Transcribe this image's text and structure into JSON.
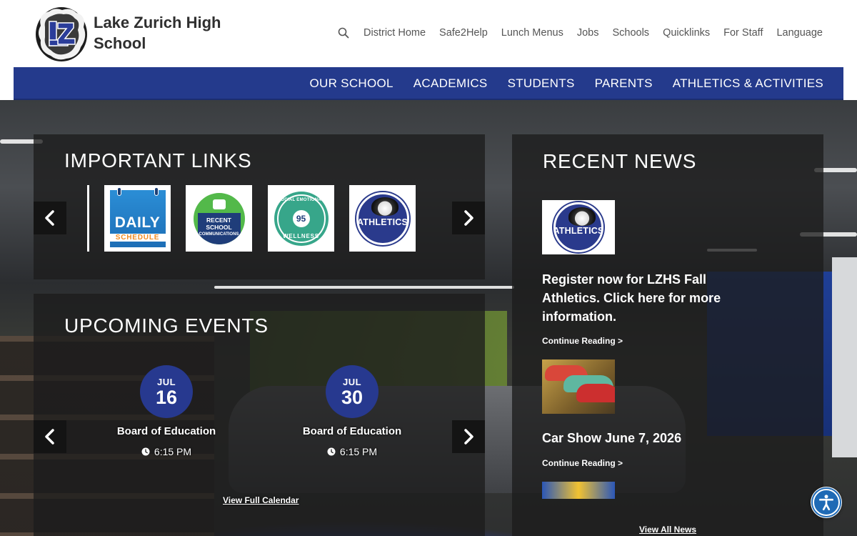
{
  "header": {
    "school_name": "Lake Zurich High School",
    "utility_nav": [
      "District Home",
      "Safe2Help",
      "Lunch Menus",
      "Jobs",
      "Schools",
      "Quicklinks",
      "For Staff",
      "Language"
    ]
  },
  "main_nav": {
    "items": [
      "OUR SCHOOL",
      "ACADEMICS",
      "STUDENTS",
      "PARENTS",
      "ATHLETICS & ACTIVITIES"
    ]
  },
  "important_links": {
    "title": "IMPORTANT LINKS",
    "tiles": [
      {
        "word": "DAILY",
        "sub": "SCHEDULE"
      },
      {
        "lines": [
          "RECENT",
          "SCHOOL",
          "COMMUNICATIONS"
        ]
      },
      {
        "top": "SOCIAL EMOTIONAL",
        "number": "95",
        "bottom": "WELLNESS"
      },
      {
        "word": "ATHLETICS"
      }
    ]
  },
  "upcoming_events": {
    "title": "UPCOMING EVENTS",
    "events": [
      {
        "month": "JUL",
        "day": "16",
        "title": "Board of Education",
        "time": "6:15 PM"
      },
      {
        "month": "JUL",
        "day": "30",
        "title": "Board of Education",
        "time": "6:15 PM"
      }
    ],
    "view_all": "View Full Calendar"
  },
  "recent_news": {
    "title": "RECENT NEWS",
    "items": [
      {
        "image_word": "ATHLETICS",
        "headline": "Register now for LZHS Fall Athletics. Click here for more information.",
        "continue": "Continue Reading >"
      },
      {
        "headline": "Car Show June 7, 2026",
        "continue": "Continue Reading >"
      }
    ],
    "view_all": "View All News"
  },
  "colors": {
    "nav_blue": "#243a8c",
    "panel_bg": "rgba(28,28,28,0.78)",
    "date_circle": "#27398f"
  }
}
